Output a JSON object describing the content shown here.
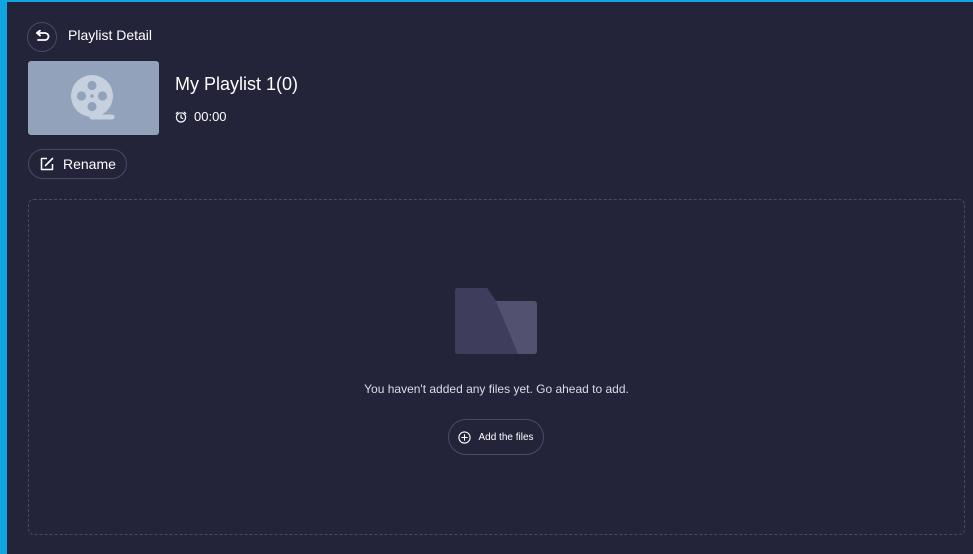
{
  "header": {
    "title": "Playlist Detail",
    "back_icon": "back-arrow-icon"
  },
  "playlist": {
    "name": "My Playlist 1(0)",
    "duration": "00:00",
    "thumbnail_icon": "film-reel-icon",
    "duration_icon": "clock-icon"
  },
  "actions": {
    "rename_label": "Rename",
    "rename_icon": "edit-icon"
  },
  "empty_state": {
    "icon": "folder-icon",
    "message": "You haven't added any files yet. Go ahead to add.",
    "add_label": "Add the files",
    "add_icon": "plus-circle-icon"
  },
  "colors": {
    "background": "#23233a",
    "window_border": "#0ea5e0",
    "thumbnail_bg": "#93a2bb",
    "control_border": "#4a4a62",
    "text": "#ffffff"
  }
}
